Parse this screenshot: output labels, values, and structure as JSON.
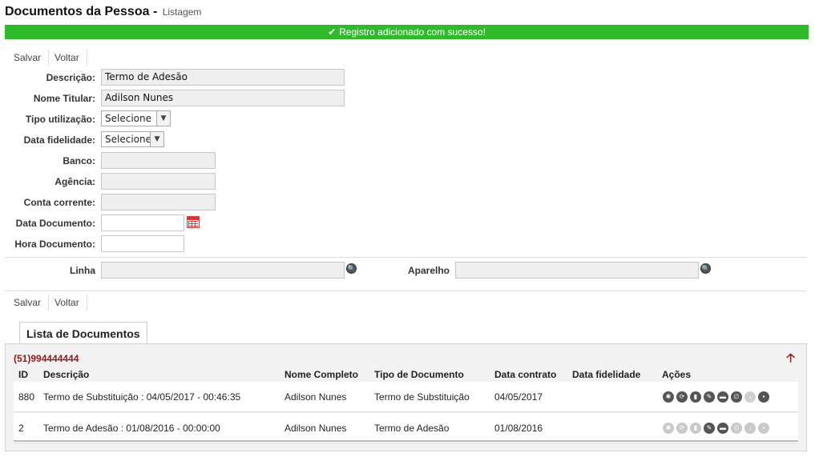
{
  "page": {
    "title": "Documentos da Pessoa -",
    "subtitle": "Listagem",
    "success_message": "Registro adicionado com sucesso!"
  },
  "toolbar": {
    "save_label": "Salvar",
    "back_label": "Voltar"
  },
  "form": {
    "descricao_label": "Descrição:",
    "descricao_value": "Termo de Adesão",
    "nome_titular_label": "Nome Titular:",
    "nome_titular_value": "Adilson Nunes",
    "tipo_utilizacao_label": "Tipo utilização:",
    "tipo_utilizacao_value": "Selecione",
    "data_fidelidade_label": "Data fidelidade:",
    "data_fidelidade_value": "Selecione",
    "banco_label": "Banco:",
    "banco_value": "",
    "agencia_label": "Agência:",
    "agencia_value": "",
    "conta_label": "Conta corrente:",
    "conta_value": "",
    "data_documento_label": "Data Documento:",
    "data_documento_value": "",
    "hora_documento_label": "Hora Documento:",
    "hora_documento_value": "",
    "linha_label": "Linha",
    "linha_value": "",
    "aparelho_label": "Aparelho",
    "aparelho_value": ""
  },
  "documents": {
    "tab_label": "Lista de Documentos",
    "phone": "(51)994444444",
    "columns": {
      "id": "ID",
      "descricao": "Descrição",
      "nome": "Nome Completo",
      "tipo": "Tipo de Documento",
      "data_contrato": "Data contrato",
      "data_fidelidade": "Data fidelidade",
      "acoes": "Ações"
    },
    "rows": [
      {
        "id": "880",
        "descricao": "Termo de Substituição : 04/05/2017 - 00:46:35",
        "nome": "Adilson Nunes",
        "tipo": "Termo de Substituição",
        "data_contrato": "04/05/2017",
        "data_fidelidade": ""
      },
      {
        "id": "2",
        "descricao": "Termo de Adesão : 01/08/2016 - 00:00:00",
        "nome": "Adilson Nunes",
        "tipo": "Termo de Adesão",
        "data_contrato": "01/08/2016",
        "data_fidelidade": ""
      }
    ]
  },
  "colors": {
    "success": "#2fba2b",
    "accent_dark_red": "#8b1a1a"
  }
}
